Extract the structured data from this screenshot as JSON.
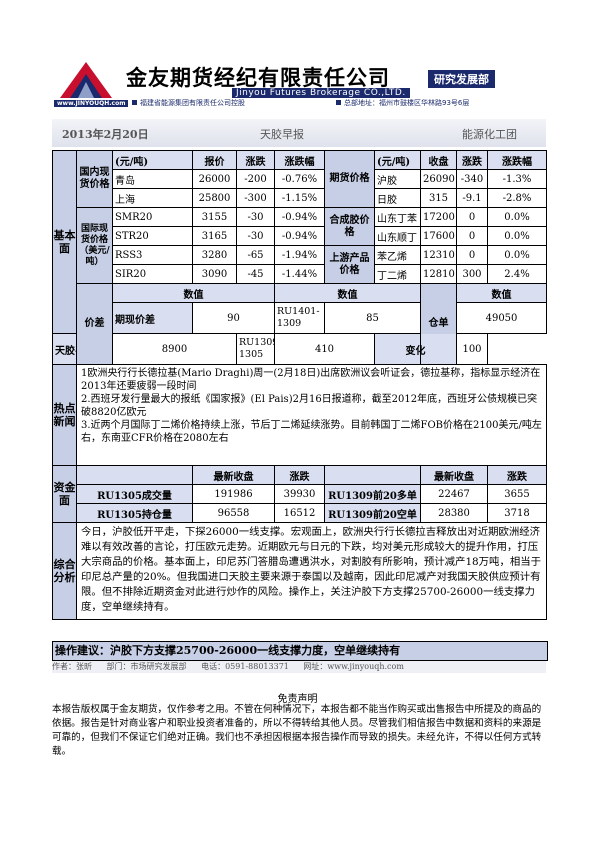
{
  "header": {
    "website": "www.JINYOUQH.com",
    "company_cn": "金友期货经纪有限责任公司",
    "company_en": "Jinyou Futures Brokerage CO.,LTD.",
    "department": "研究发展部",
    "parent": "福建省能源集团有限责任公司控股",
    "address": "总部地址：福州市鼓楼区华林路93号6层"
  },
  "titlebar": {
    "date": "2013年2月20日",
    "report_type": "天胶早报",
    "group": "能源化工团"
  },
  "basics": {
    "section_label": "基本面",
    "domestic_label": "国内现货价格",
    "intl_label": "国际现货价格（美元/吨）",
    "unit": "(元/吨)",
    "col_price": "报价",
    "col_chg": "涨跌",
    "col_pct": "涨跌幅",
    "domestic": [
      {
        "name": "青岛",
        "price": "26000",
        "chg": "-200",
        "pct": "-0.76%"
      },
      {
        "name": "上海",
        "price": "25800",
        "chg": "-300",
        "pct": "-1.15%"
      }
    ],
    "intl": [
      {
        "name": "SMR20",
        "price": "3155",
        "chg": "-30",
        "pct": "-0.94%"
      },
      {
        "name": "STR20",
        "price": "3165",
        "chg": "-30",
        "pct": "-0.94%"
      },
      {
        "name": "RSS3",
        "price": "3280",
        "chg": "-65",
        "pct": "-1.94%"
      },
      {
        "name": "SIR20",
        "price": "3090",
        "chg": "-45",
        "pct": "-1.44%"
      }
    ],
    "futures_label": "期货价格",
    "synth_label": "合成胶价格",
    "upstream_label": "上游产品价格",
    "unit2": "(元/吨)",
    "col_close": "收盘",
    "futures": [
      {
        "name": "沪胶",
        "close": "26090",
        "chg": "-340",
        "pct": "-1.3%"
      },
      {
        "name": "日胶",
        "close": "315",
        "chg": "-9.1",
        "pct": "-2.8%"
      }
    ],
    "synth": [
      {
        "name": "山东丁苯",
        "close": "17200",
        "chg": "0",
        "pct": "0.0%"
      },
      {
        "name": "山东顺丁",
        "close": "17600",
        "chg": "0",
        "pct": "0.0%"
      }
    ],
    "upstream": [
      {
        "name": "苯乙烯",
        "close": "12310",
        "chg": "0",
        "pct": "0.0%"
      },
      {
        "name": "丁二烯",
        "close": "12810",
        "chg": "300",
        "pct": "2.4%"
      }
    ],
    "spread": {
      "label": "价差",
      "col_value": "数值",
      "spot_label": "期现价差",
      "spot_value": "90",
      "cal1_label": "RU1401-1309",
      "cal1_value": "85",
      "synth_label": "天胶-合成胶",
      "synth_value": "8900",
      "cal2_label": "RU1309-1305",
      "cal2_value": "410",
      "warrant_label": "仓单",
      "warrant_value": "49050",
      "change_label": "变化",
      "change_value": "100"
    }
  },
  "news": {
    "section_label": "热点新闻",
    "items": [
      "1欧洲央行行长德拉基(Mario Draghi)周一(2月18日)出席欧洲议会听证会，德拉基称，指标显示经济在2013年还要疲弱一段时间",
      "2.西班牙发行量最大的报纸《国家报》(El Pais)2月16日报道称，截至2012年底，西班牙公债规模已突破8820亿欧元",
      "3.近两个月国际丁二烯价格持续上涨，节后丁二烯延续涨势。目前韩国丁二烯FOB价格在2100美元/吨左右，东南亚CFR价格在2080左右"
    ]
  },
  "funds": {
    "section_label": "资金面",
    "col_close": "最新收盘",
    "col_chg": "涨跌",
    "rows": [
      {
        "name": "RU1305成交量",
        "close": "191986",
        "chg": "39930",
        "name2": "RU1309前20多单",
        "close2": "22467",
        "chg2": "3655"
      },
      {
        "name": "RU1305持仓量",
        "close": "96558",
        "chg": "16512",
        "name2": "RU1309前20空单",
        "close2": "28380",
        "chg2": "3718"
      }
    ]
  },
  "analysis": {
    "section_label": "综合分析",
    "text": "今日，沪胶低开平走，下探26000一线支撑。宏观面上，欧洲央行行长德拉吉释放出对近期欧洲经济难以有效改善的言论，打压欧元走势。近期欧元与日元的下跌，均对美元形成较大的提升作用，打压大宗商品的价格。基本面上，印尼苏门答腊岛遭遇洪水，对割胶有所影响，预计减产18万吨，相当于印尼总产量的20%。但我国进口天胶主要来源于泰国以及越南，因此印尼减产对我国天胶供应预计有限。但不排除近期资金对此进行炒作的风险。操作上，关注沪胶下方支撑25700-26000一线支撑力度，空单继续持有。"
  },
  "advice": "操作建议：沪胶下方支撑25700-26000一线支撑力度，空单继续持有",
  "footer": {
    "author": "作者：张昕",
    "department": "部门：市场研究发展部",
    "phone": "电话：0591-88013371",
    "website": "网址：www.jinyouqh.com"
  },
  "disclaimer": {
    "title": "免责声明",
    "text": "本报告版权属于金友期货，仅作参考之用。不管在何种情况下，本报告都不能当作购买或出售报告中所提及的商品的依据。报告是针对商业客户和职业投资者准备的，所以不得转给其他人员。尽管我们相信报告中数据和资料的来源是可靠的，但我们不保证它们绝对正确。我们也不承担因根据本报告操作而导致的损失。未经允许，不得以任何方式转载。"
  },
  "colors": {
    "navy": "#1a2a6c",
    "header_blue": "#c7cfe6",
    "logo_red": "#c8102e"
  }
}
